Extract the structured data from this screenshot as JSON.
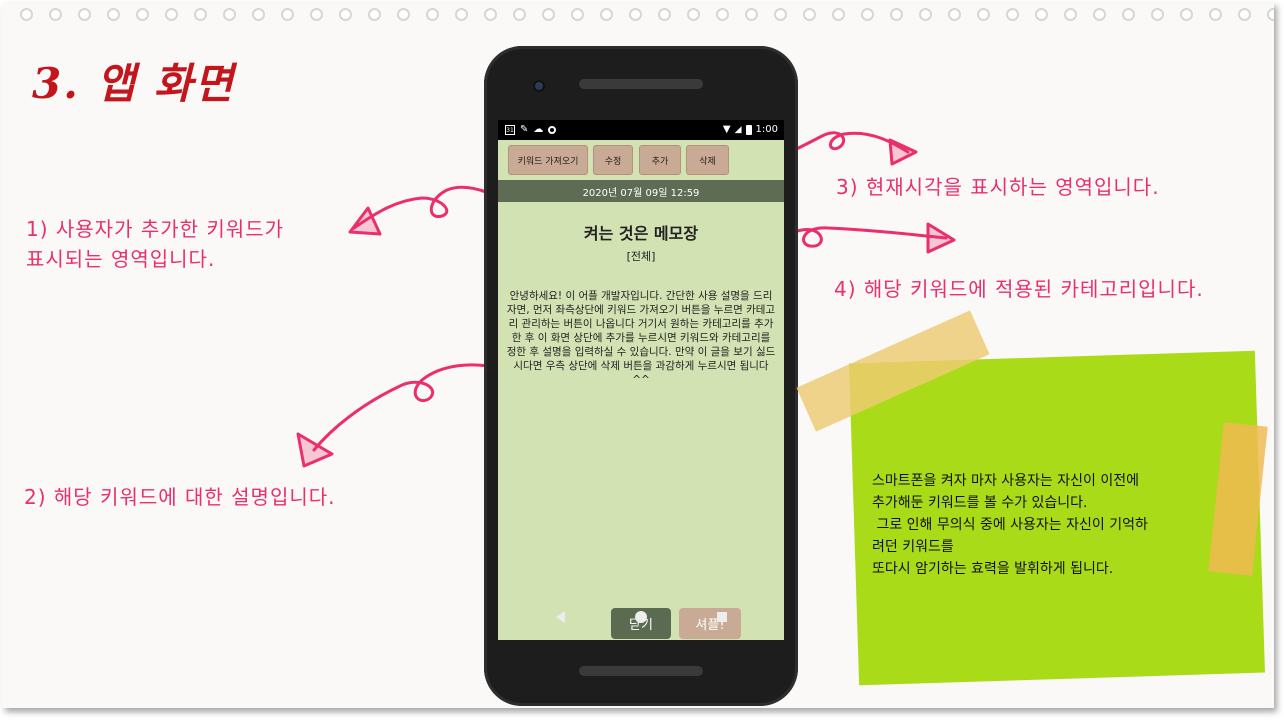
{
  "slide": {
    "title": "3. 앱 화면",
    "annotations": {
      "a1_line1": "1) 사용자가 추가한 키워드가",
      "a1_line2": "표시되는 영역입니다.",
      "a2": "2) 해당 키워드에 대한 설명입니다.",
      "a3": "3) 현재시각을 표시하는 영역입니다.",
      "a4": "4) 해당 키워드에 적용된 카테고리입니다."
    },
    "sticky_note": {
      "text": "스마트폰을 켜자 마자 사용자는 자신이 이전에\n추가해둔 키워드를 볼 수가 있습니다.\n 그로 인해 무의식 중에 사용자는 자신이 기억하\n려던 키워드를\n또다시 암기하는 효력을 발휘하게 됩니다."
    },
    "colors": {
      "title": "#c4141c",
      "annotation": "#ea2f6a",
      "sticky": "#a9db18",
      "app_background": "#d3e2b3",
      "button_tan": "#c9aa94",
      "button_dark": "#5b6b52"
    }
  },
  "phone": {
    "status_bar": {
      "calendar": "31",
      "time": "1:00"
    },
    "toolbar": {
      "import_label": "키워드 가져오기",
      "edit_label": "수정",
      "add_label": "추가",
      "delete_label": "삭제"
    },
    "datetime": "2020년 07월 09일 12:59",
    "memo": {
      "title": "켜는 것은 메모장",
      "category": "[전체]",
      "description": "안녕하세요! 이 어플 개발자입니다. 간단한 사용 설명을 드리자면, 먼저 좌측상단에 키워드 가져오기 버튼을 누르면 카테고리 관리하는 버튼이 나옵니다 거기서 원하는 카테고리를 추가한 후 이 화면 상단에 추가를 누르시면 키워드와 카테고리를 정한 후 설명을 입력하실 수 있습니다. 만약 이 글을 보기 싫드시다면 우측 상단에 삭제 버튼을 과감하게 누르시면 됩니다 ^^"
    },
    "bottom_buttons": {
      "close_label": "닫기",
      "shuffle_label": "셔플!"
    },
    "nav": {
      "back_icon": "back-triangle-icon",
      "home_icon": "home-circle-icon",
      "recents_icon": "recents-square-icon"
    }
  }
}
